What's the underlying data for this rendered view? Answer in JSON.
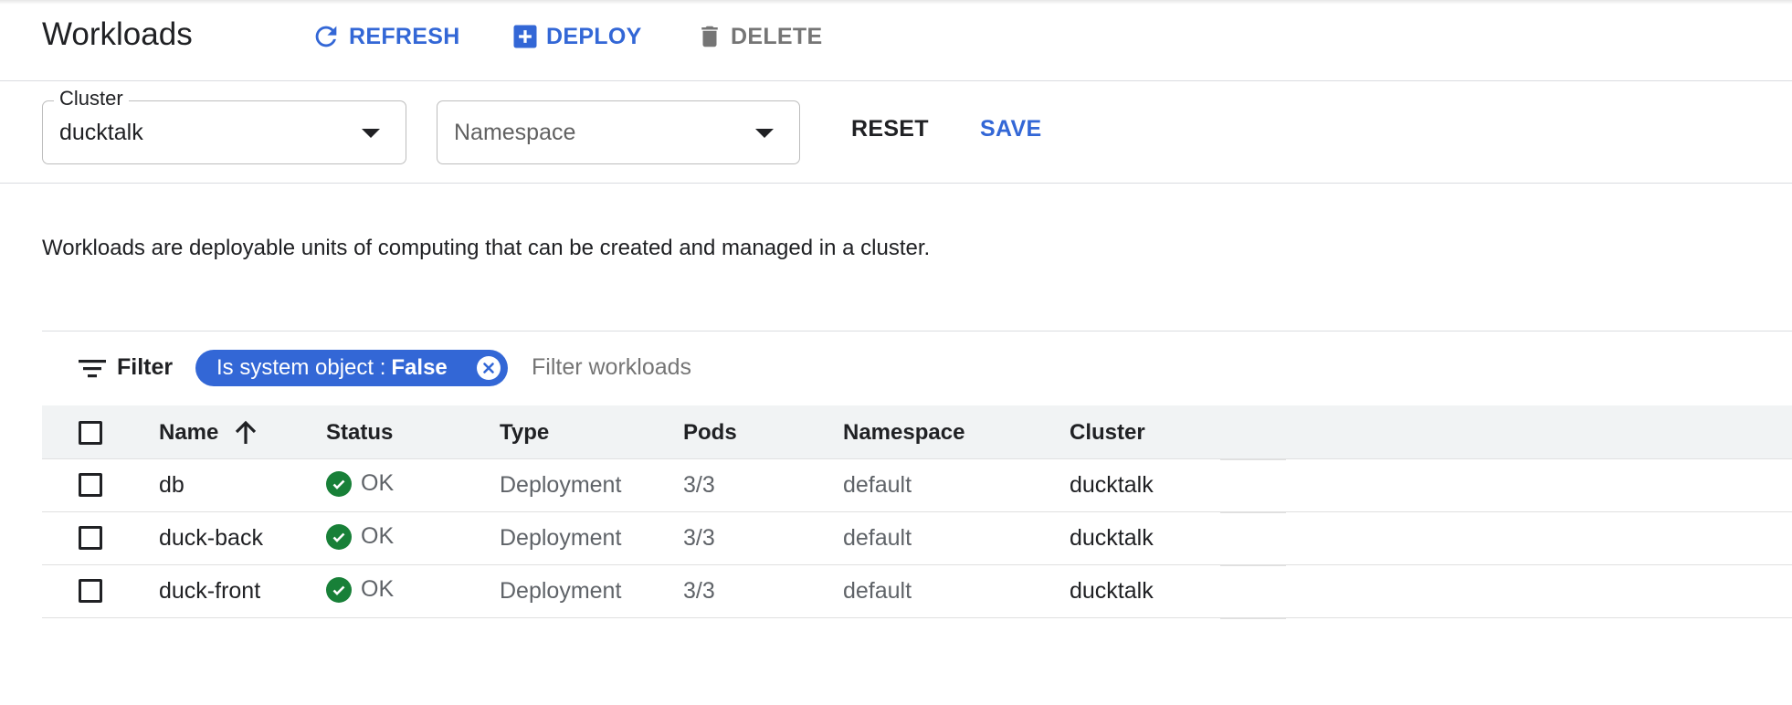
{
  "header": {
    "title": "Workloads",
    "refresh_label": "REFRESH",
    "deploy_label": "DEPLOY",
    "delete_label": "DELETE"
  },
  "selectors": {
    "cluster": {
      "label": "Cluster",
      "value": "ducktalk"
    },
    "namespace": {
      "placeholder": "Namespace"
    },
    "reset_label": "RESET",
    "save_label": "SAVE"
  },
  "description": "Workloads are deployable units of computing that can be created and managed in a cluster.",
  "filter": {
    "label": "Filter",
    "chip_key": "Is system object :",
    "chip_value": "False",
    "placeholder": "Filter workloads"
  },
  "table": {
    "headers": {
      "name": "Name",
      "status": "Status",
      "type": "Type",
      "pods": "Pods",
      "namespace": "Namespace",
      "cluster": "Cluster"
    },
    "rows": [
      {
        "name": "db",
        "status": "OK",
        "type": "Deployment",
        "pods": "3/3",
        "namespace": "default",
        "cluster": "ducktalk"
      },
      {
        "name": "duck-back",
        "status": "OK",
        "type": "Deployment",
        "pods": "3/3",
        "namespace": "default",
        "cluster": "ducktalk"
      },
      {
        "name": "duck-front",
        "status": "OK",
        "type": "Deployment",
        "pods": "3/3",
        "namespace": "default",
        "cluster": "ducktalk"
      }
    ]
  },
  "colors": {
    "accent": "#3367d6",
    "status_ok": "#188038",
    "muted": "#757575"
  },
  "icons": {
    "refresh": "refresh-icon",
    "deploy": "add-box-icon",
    "delete": "trash-icon",
    "filter": "filter-list-icon",
    "sort": "arrow-up-icon",
    "status": "check-circle-icon",
    "chip_close": "close-circle-icon"
  }
}
